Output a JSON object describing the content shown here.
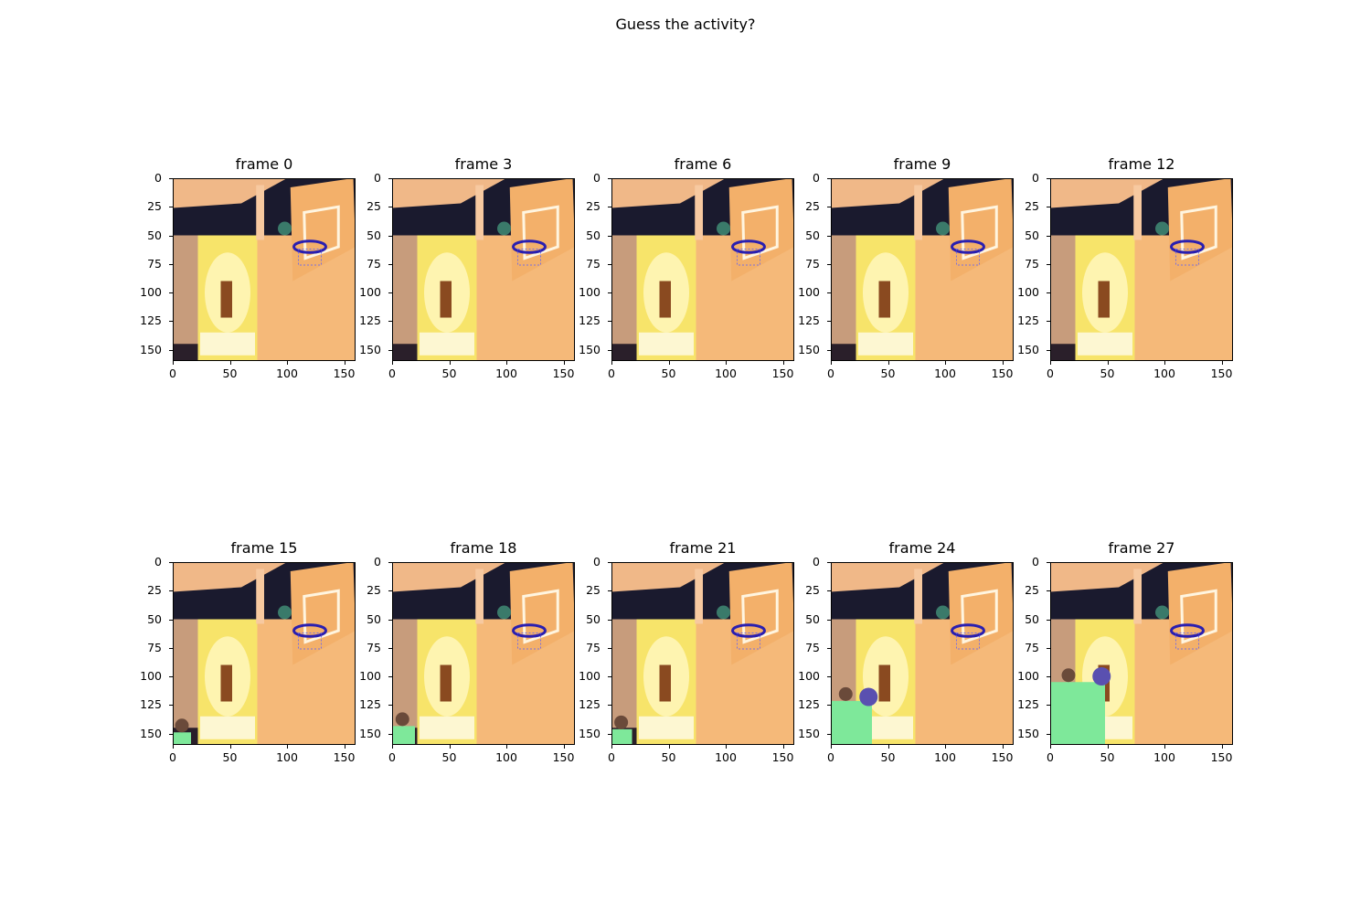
{
  "figure": {
    "title": "Guess the activity?"
  },
  "chart_data": {
    "type": "image_grid",
    "rows": 2,
    "cols": 5,
    "panels": [
      {
        "title": "frame 0",
        "frame": 0,
        "person_visible": 0.0
      },
      {
        "title": "frame 3",
        "frame": 3,
        "person_visible": 0.0
      },
      {
        "title": "frame 6",
        "frame": 6,
        "person_visible": 0.0
      },
      {
        "title": "frame 9",
        "frame": 9,
        "person_visible": 0.0
      },
      {
        "title": "frame 12",
        "frame": 12,
        "person_visible": 0.0
      },
      {
        "title": "frame 15",
        "frame": 15,
        "person_visible": 0.2
      },
      {
        "title": "frame 18",
        "frame": 18,
        "person_visible": 0.3
      },
      {
        "title": "frame 21",
        "frame": 21,
        "person_visible": 0.25
      },
      {
        "title": "frame 24",
        "frame": 24,
        "person_visible": 0.7
      },
      {
        "title": "frame 27",
        "frame": 27,
        "person_visible": 1.0
      }
    ],
    "xticks": [
      "0",
      "50",
      "100",
      "150"
    ],
    "yticks": [
      "0",
      "25",
      "50",
      "75",
      "100",
      "125",
      "150"
    ],
    "xlim": [
      0,
      160
    ],
    "ylim": [
      160,
      0
    ]
  },
  "colors": {
    "ceiling": "#1a1a2e",
    "banner": "#f7e46a",
    "backboard": "#f3b06a",
    "wall": "#f5b979",
    "rim": "#2a1fb0",
    "person": "#7ee89a"
  }
}
